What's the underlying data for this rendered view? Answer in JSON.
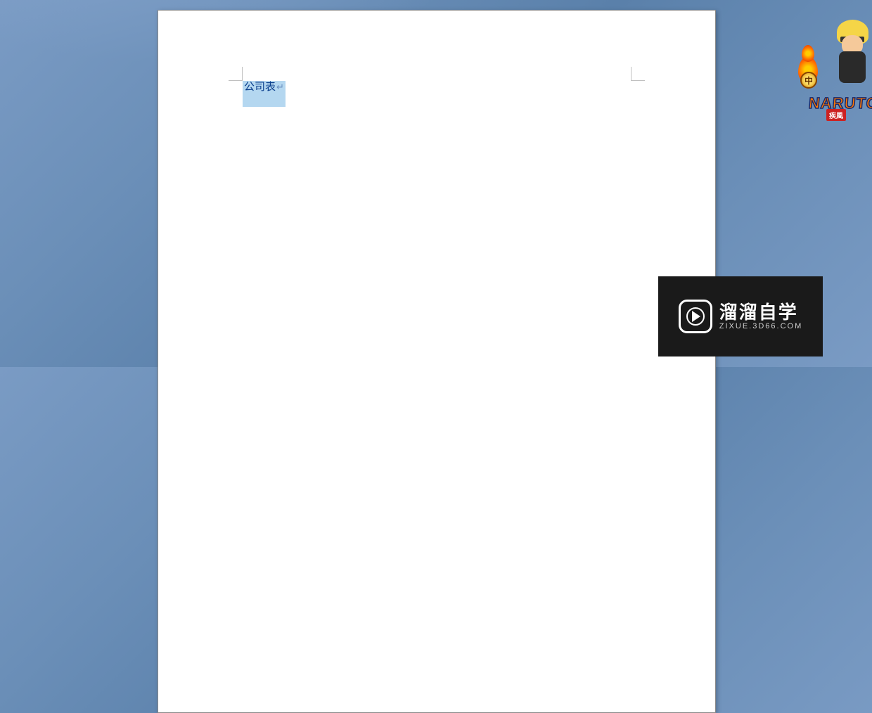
{
  "document": {
    "selected_text": "公司表",
    "paragraph_mark": "↵"
  },
  "watermark": {
    "title": "溜溜自学",
    "url": "ZIXUE.3D66.COM"
  },
  "art": {
    "badge_text": "中",
    "logo_text": "NARUTO",
    "subtitle": "疾風"
  }
}
